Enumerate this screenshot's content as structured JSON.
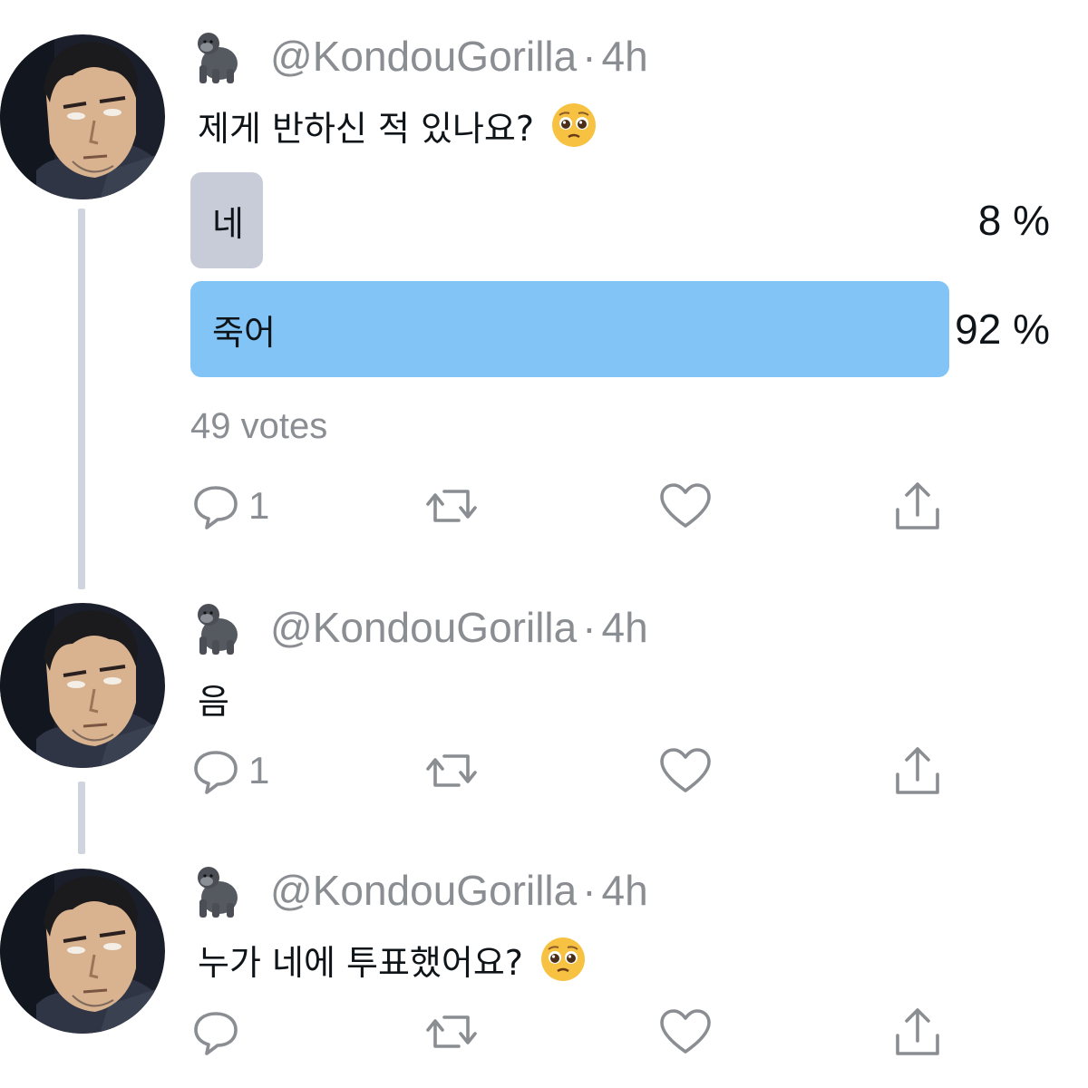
{
  "thread": [
    {
      "handle": "@KondouGorilla",
      "separator": "·",
      "time": "4h",
      "text": "제게 반하신 적 있나요?",
      "has_emoji": true,
      "poll": {
        "options": [
          {
            "label": "네",
            "percent": "8 %",
            "fraction": 0.08,
            "color": "#c8ccd8"
          },
          {
            "label": "죽어",
            "percent": "92 %",
            "fraction": 0.92,
            "color": "#82c4f5"
          }
        ],
        "votes": "49 votes"
      },
      "reply_count": "1"
    },
    {
      "handle": "@KondouGorilla",
      "separator": "·",
      "time": "4h",
      "text": "음",
      "reply_count": "1"
    },
    {
      "handle": "@KondouGorilla",
      "separator": "·",
      "time": "4h",
      "text": "누가 네에 투표했어요?",
      "has_emoji": true,
      "reply_count": ""
    }
  ],
  "icons": {
    "reply": "reply-icon",
    "retweet": "retweet-icon",
    "like": "heart-icon",
    "share": "share-icon",
    "badge": "gorilla-icon",
    "emoji": "pleading-face-emoji"
  },
  "colors": {
    "muted": "#8a8d91",
    "thread_line": "#cfd5de",
    "poll_winner": "#82c4f5",
    "poll_other": "#c8ccd8"
  }
}
